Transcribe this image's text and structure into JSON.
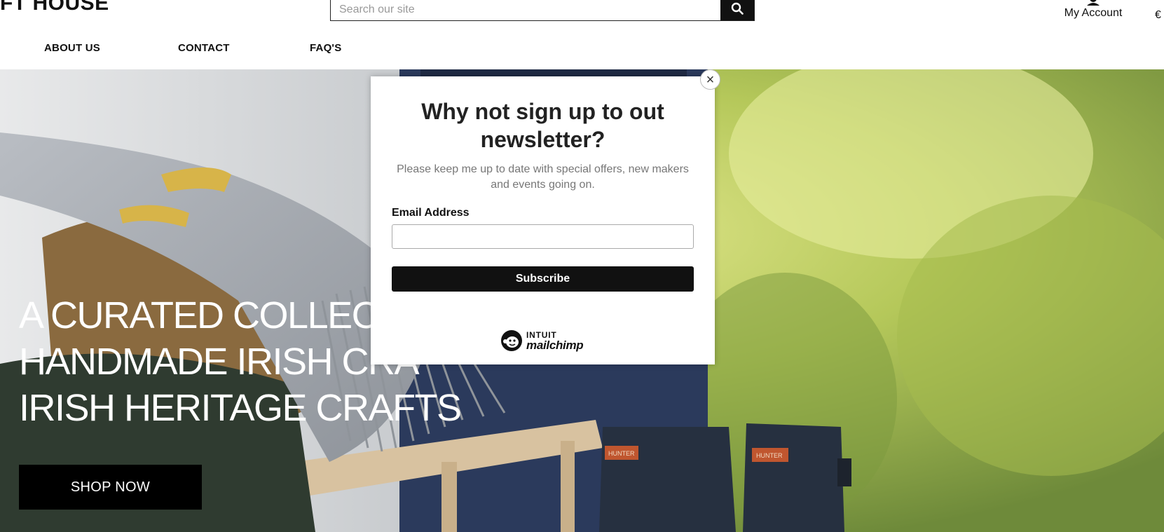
{
  "header": {
    "logo_text": "FT HOUSE",
    "search_placeholder": "Search our site",
    "search_value": "",
    "account_label": "My Account",
    "currency_symbol": "€"
  },
  "nav": {
    "items": [
      {
        "label": "ABOUT US"
      },
      {
        "label": "CONTACT"
      },
      {
        "label": "FAQ'S"
      }
    ]
  },
  "hero": {
    "title_lines": [
      "A CURATED COLLECT",
      "HANDMADE IRISH CRA",
      "IRISH HERITAGE CRAFTS"
    ],
    "button_label": "SHOP NOW",
    "boot_label": "HUNTER"
  },
  "modal": {
    "title": "Why not sign up to out newsletter?",
    "description": "Please keep me up to date with special offers, new makers and events going on.",
    "email_label": "Email Address",
    "email_value": "",
    "subscribe_label": "Subscribe",
    "close_symbol": "×",
    "badge": {
      "line1": "INTUIT",
      "line2": "mailchimp"
    }
  },
  "colors": {
    "primary_button": "#000000",
    "modal_background": "#ffffff",
    "hero_text": "#ffffff"
  },
  "icons": {
    "search": "search-icon",
    "account": "account-icon",
    "close": "close-icon",
    "mailchimp": "mailchimp-logo-icon"
  }
}
